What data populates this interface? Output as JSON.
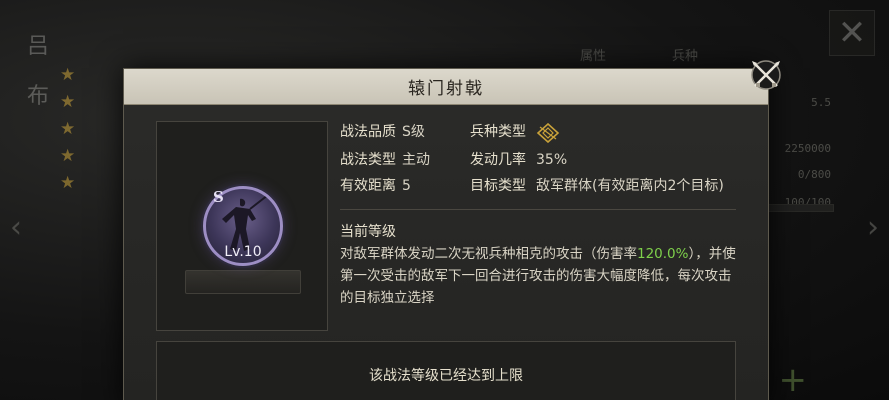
{
  "background": {
    "char_name": [
      "吕",
      "布"
    ],
    "star_count": 5,
    "tabs": [
      "属性",
      "兵种"
    ],
    "stats": [
      "5.5",
      "2250000",
      "0/800",
      "100/100"
    ]
  },
  "dialog": {
    "title": "辕门射戟",
    "skill": {
      "grade_letter": "S",
      "level_label": "Lv.10"
    },
    "info": {
      "quality_label": "战法品质",
      "quality_value": "S级",
      "troop_label": "兵种类型",
      "type_label": "战法类型",
      "type_value": "主动",
      "trigger_label": "发动几率",
      "trigger_value": "35%",
      "range_label": "有效距离",
      "range_value": "5",
      "target_label": "目标类型",
      "target_value": "敌军群体(有效距离内2个目标)"
    },
    "current_level_label": "当前等级",
    "description": {
      "part1": "对敌军群体发动二次无视兵种相克的攻击（伤害率",
      "highlight": "120.0%",
      "part2": "），并使第一次受击的敌军下一回合进行攻击的伤害大幅度降低，每次攻击的目标独立选择"
    },
    "max_level_text": "该战法等级已经达到上限"
  },
  "colors": {
    "highlight": "#7ed04b",
    "header_bg": "#d4d0c3",
    "star": "#c9a23a"
  }
}
